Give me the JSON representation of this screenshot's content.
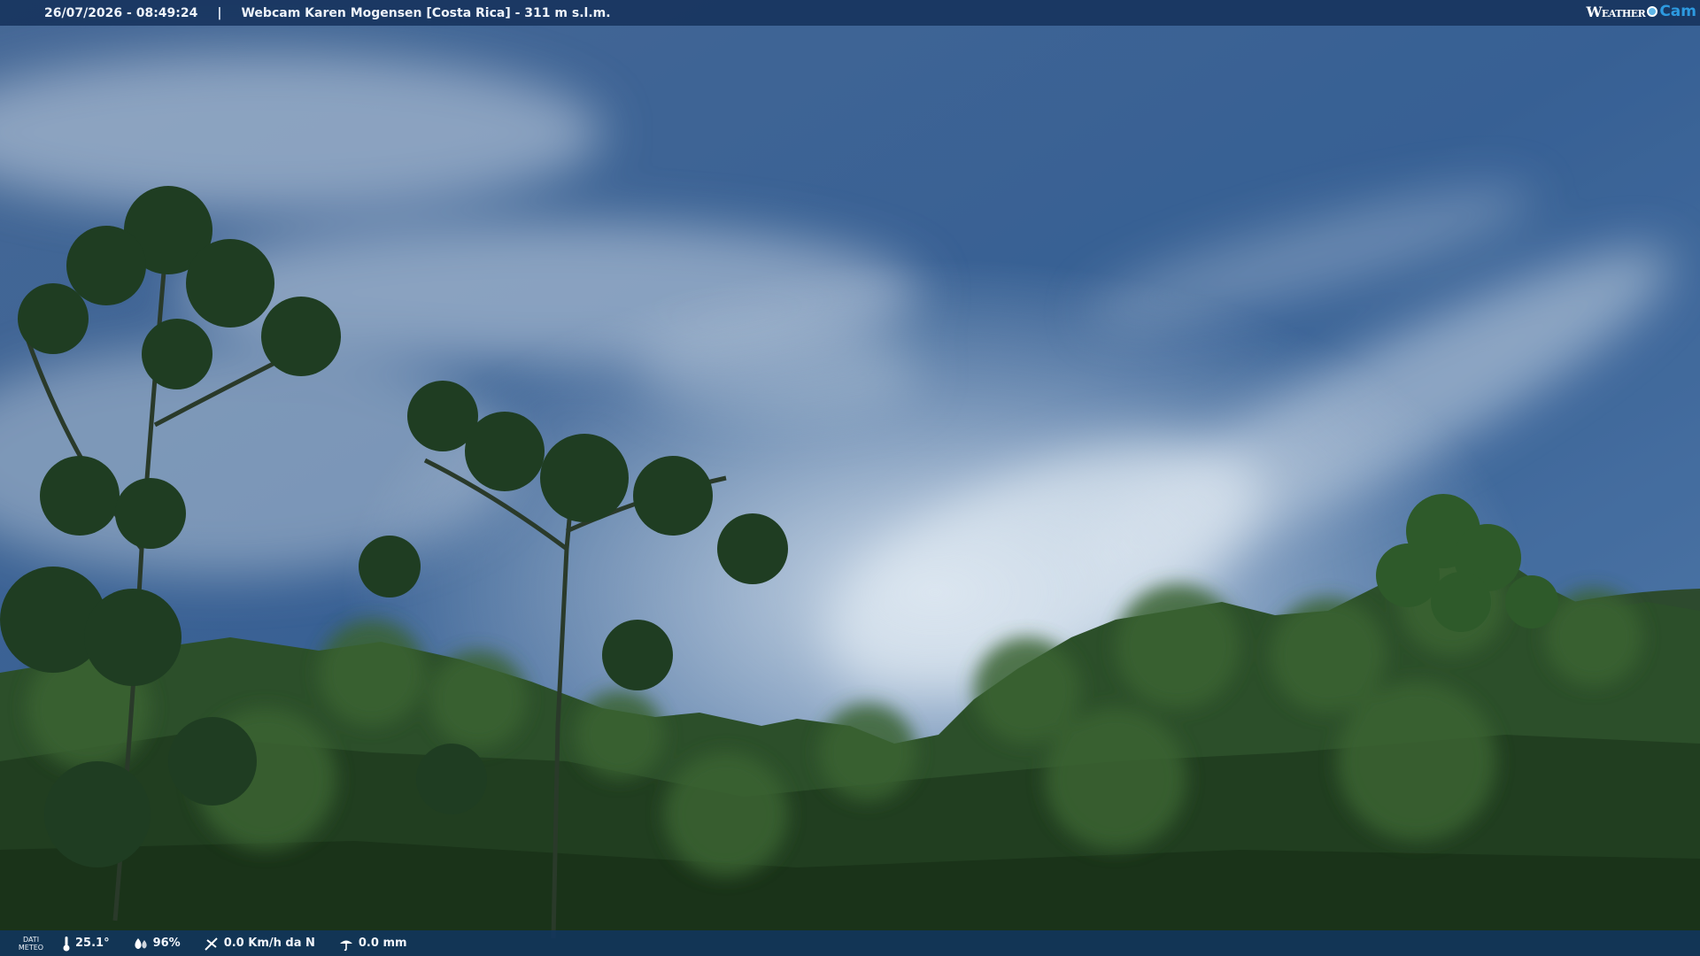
{
  "header": {
    "timestamp": "26/07/2026 - 08:49:24",
    "separator": "|",
    "title": "Webcam Karen Mogensen [Costa Rica] - 311 m s.l.m."
  },
  "brand": {
    "weather": "Weather",
    "cam": "Cam"
  },
  "footer": {
    "label_line1": "DATI",
    "label_line2": "METEO",
    "temperature": "25.1°",
    "humidity": "96%",
    "wind": "0.0 Km/h da N",
    "rain": "0.0 mm"
  },
  "icons": [
    "thermometer-icon",
    "humidity-icon",
    "wind-icon",
    "rain-icon"
  ]
}
